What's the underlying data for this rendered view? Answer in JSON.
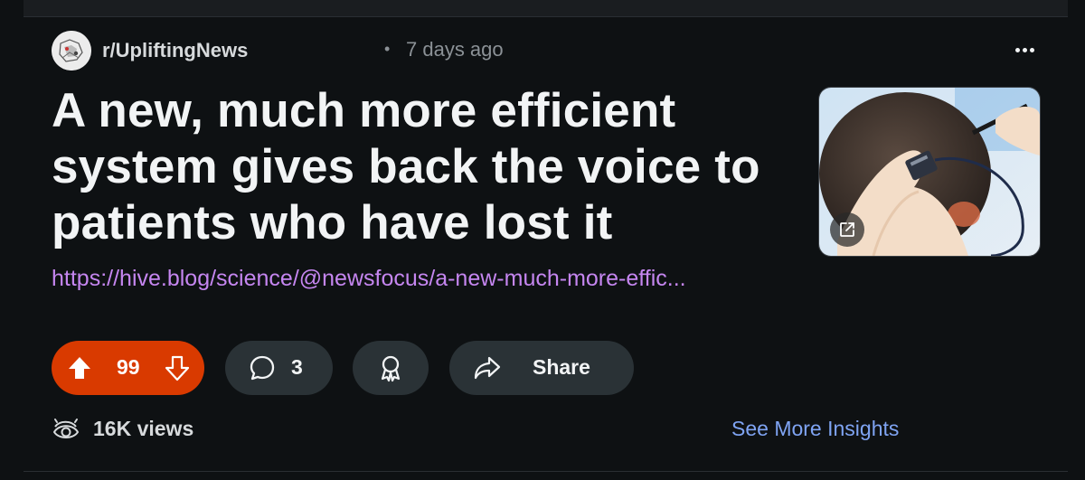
{
  "post": {
    "subreddit": "r/UpliftingNews",
    "separator": "•",
    "time_ago": "7 days ago",
    "title": "A new, much more efficient system gives back the voice to patients who have lost it",
    "link": "https://hive.blog/science/@newsfocus/a-new-much-more-effic...",
    "thumbnail_icon": "external-link-icon"
  },
  "actions": {
    "score": "99",
    "comments": "3",
    "share_label": "Share"
  },
  "footer": {
    "views": "16K views",
    "insights_label": "See More Insights"
  },
  "colors": {
    "background": "#0e1113",
    "upvote_active": "#d93a00",
    "pill": "#2a3236",
    "link": "#c586f0",
    "insights": "#7fa4f3"
  }
}
